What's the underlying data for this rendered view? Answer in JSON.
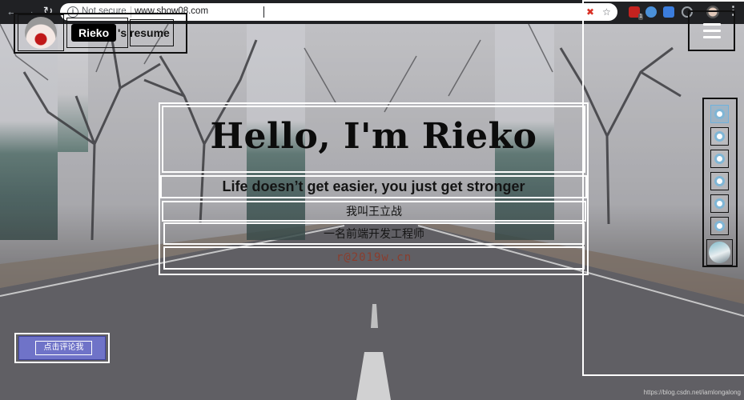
{
  "browser": {
    "security_label": "Not secure",
    "url": "www.show08.com",
    "ext_badge": "1"
  },
  "header": {
    "name": "Rieko",
    "suffix": "'s resume"
  },
  "hero": {
    "title": "Hello, I'm Rieko",
    "tagline": "Life doesn’t get easier, you just get stronger",
    "chinese_name": "我叫王立战",
    "job_title": "一名前端开发工程师",
    "email": "r@2019w.cn"
  },
  "nav_dots": {
    "count": 6,
    "active_index": 0
  },
  "comment_button": {
    "label": "点击评论我"
  },
  "watermark": "https://blog.csdn.net/iamlongalong",
  "colors": {
    "accent_button": "#6f73c8",
    "email_text": "#8a3d2d",
    "chrome_bg": "#202124"
  }
}
